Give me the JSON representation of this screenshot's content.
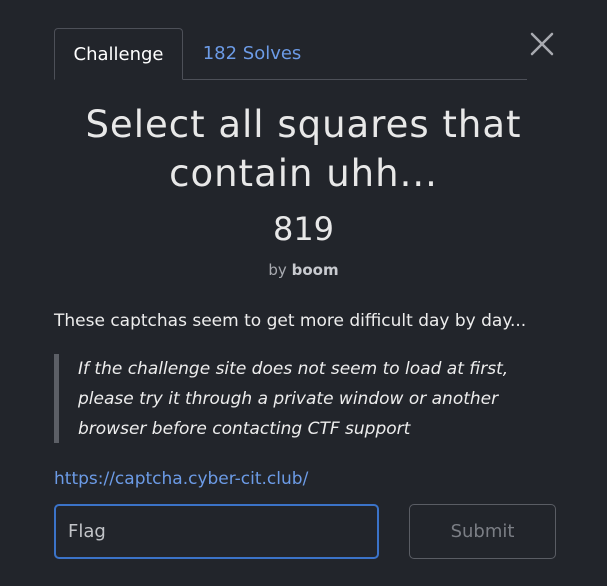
{
  "tabs": {
    "challenge_label": "Challenge",
    "solves_label": "182 Solves"
  },
  "challenge": {
    "title_line1": "Select all squares that",
    "title_line2": "contain uhh...",
    "points": "819",
    "author_prefix": "by",
    "author_name": "boom",
    "description": "These captchas seem to get more difficult day by day...",
    "note_line1": "If the challenge site does not seem to load at first,",
    "note_line2": "please try it through a private window or another",
    "note_line3": "browser before contacting CTF support",
    "link": "https://captcha.cyber-cit.club/"
  },
  "form": {
    "flag_placeholder": "Flag",
    "flag_value": "",
    "submit_label": "Submit"
  },
  "icons": {
    "close": "close-icon"
  },
  "colors": {
    "background": "#22252b",
    "accent_link": "#6c9be6",
    "input_focus_border": "#3b73c8"
  }
}
